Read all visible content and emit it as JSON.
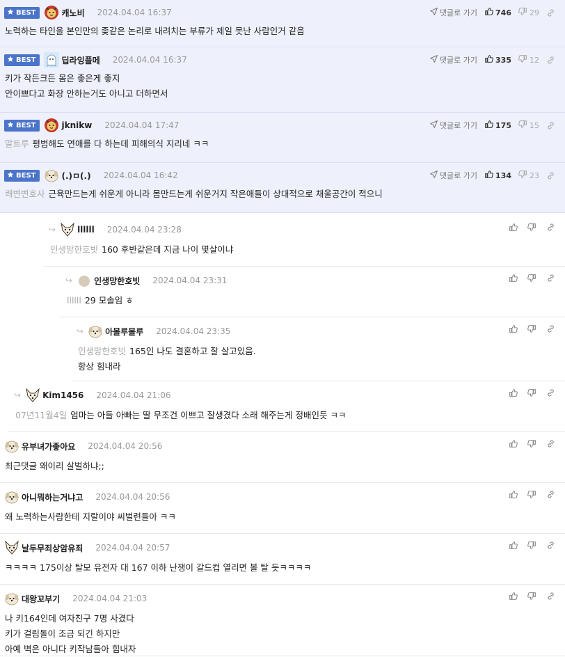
{
  "labels": {
    "best": "BEST",
    "goto": "댓글로 가기"
  },
  "best_comments": [
    {
      "nick": "캐노비",
      "date": "2024.04.04 16:37",
      "up": "746",
      "down": "29",
      "mention": "",
      "text": "노력하는 타인을 본인만의 좆같은 논리로 내려치는 부류가 제일 못난 사람인거 같음",
      "avatar": "lion-avatar"
    },
    {
      "nick": "딥라잉플메",
      "date": "2024.04.04 16:37",
      "up": "335",
      "down": "12",
      "mention": "",
      "text": "키가 작든크든 몸은 좋은게 좋지\n안이쁘다고 화장 안하는거도 아니고 더하면서",
      "avatar": "ghost-avatar"
    },
    {
      "nick": "jknikw",
      "date": "2024.04.04 17:47",
      "up": "175",
      "down": "15",
      "mention": "말트루",
      "text": "평범해도 연애를 다 하는데 피해의식 지리네 ㅋㅋ",
      "avatar": "lion-avatar"
    },
    {
      "nick": "(.)ㅁ(.)",
      "date": "2024.04.04 16:42",
      "up": "134",
      "down": "23",
      "mention": "쾌변변호사",
      "text": "근육만드는게 쉬운게 아니라 몸만드는게 쉬운거지 작은애들이 상대적으로 채울공간이 적으니",
      "avatar": "dog-avatar"
    }
  ],
  "replies": [
    {
      "nick": "llllll",
      "date": "2024.04.04 23:28",
      "mention": "인생망한호빗",
      "text": "160 후반같은데 지금 나이 몇살이냐",
      "avatar": "fox-avatar"
    },
    {
      "nick": "인생망한호빗",
      "date": "2024.04.04 23:31",
      "mention": "llllll",
      "text": "29 모솔임 ㅎ",
      "avatar": "circle-avatar"
    },
    {
      "nick": "아몰루몰루",
      "date": "2024.04.04 23:35",
      "mention": "인생망한호빗",
      "text": "165인 나도 결혼하고 잘 살고있음.\n항상 힘내라",
      "avatar": "dog-avatar"
    },
    {
      "nick": "Kim1456",
      "date": "2024.04.04 21:06",
      "mention": "07년11월4일",
      "text": "엄마는 아들 아빠는 딸 무조건 이쁘고 잘생겼다 소래 해주는게 정배인듯 ㅋㅋ",
      "avatar": "fox-avatar"
    }
  ],
  "comments": [
    {
      "nick": "유부녀가좋아요",
      "date": "2024.04.04 20:56",
      "mention": "",
      "text": "최근댓글 왜이리 살벌하냐;;",
      "avatar": "dog-avatar"
    },
    {
      "nick": "아니뭐하는거냐고",
      "date": "2024.04.04 20:56",
      "mention": "",
      "text": "왜 노력하는사람한테 지랄이야 씨벌련들아 ㅋㅋ",
      "avatar": "dog-avatar"
    },
    {
      "nick": "날두무죄상암유죄",
      "date": "2024.04.04 20:57",
      "mention": "",
      "text": "ㅋㅋㅋㅋ 175이상 탈모 유전자 대 167 이하 난쟁이 갈드컵 열리면 볼 탈 듯ㅋㅋㅋㅋ",
      "avatar": "fox-avatar"
    },
    {
      "nick": "대왕꼬부기",
      "date": "2024.04.04 21:03",
      "mention": "",
      "text": "나 키164인데 여자친구 7명 사겼다\n키가 걸림돌이 조금 되긴 하지만\n아예 벽은 아니다 키작남들아 힘내자",
      "avatar": "dog-avatar"
    }
  ],
  "colors": {
    "best_bg": "#eef1fb",
    "badge": "#4a74c9",
    "mention": "#aaaaaa"
  }
}
